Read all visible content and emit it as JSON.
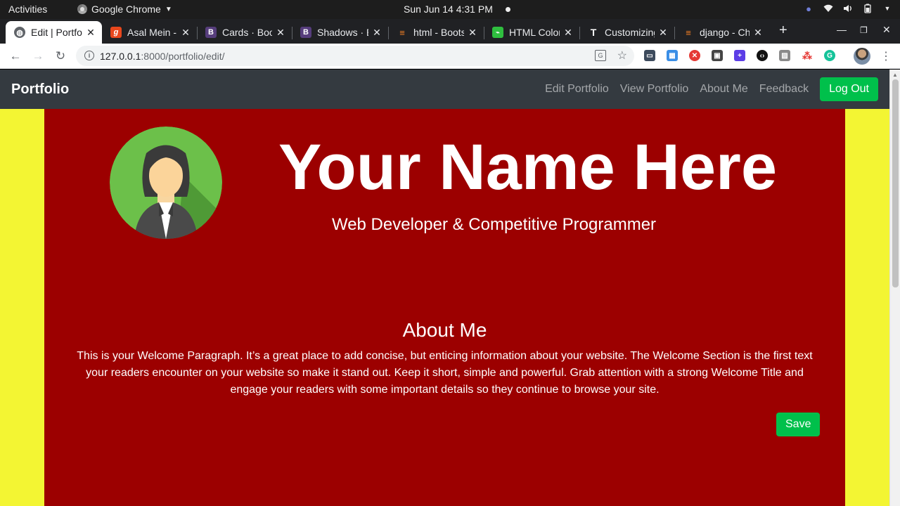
{
  "system_bar": {
    "activities": "Activities",
    "app_name": "Google Chrome",
    "clock": "Sun Jun 14   4:31 PM"
  },
  "tabs": [
    {
      "title": "Edit | Portfolio",
      "favicon": "globe-icon",
      "color": "#5f6368",
      "active": true
    },
    {
      "title": "Asal Mein - ",
      "favicon": "g",
      "color": "#e8471c",
      "active": false
    },
    {
      "title": "Cards · Bootstrap",
      "favicon": "B",
      "color": "#563d7c",
      "active": false
    },
    {
      "title": "Shadows · Bootstrap",
      "favicon": "B",
      "color": "#563d7c",
      "active": false
    },
    {
      "title": "html - Bootstrap",
      "favicon": "stackoverflow-icon",
      "color": "#f48024",
      "active": false
    },
    {
      "title": "HTML Color Codes",
      "favicon": "chart-icon",
      "color": "#2fbf3f",
      "active": false
    },
    {
      "title": "Customizing",
      "favicon": "T",
      "color": "#222222",
      "active": false
    },
    {
      "title": "django - Change",
      "favicon": "stackoverflow-icon",
      "color": "#f48024",
      "active": false
    }
  ],
  "address_bar": {
    "host": "127.0.0.1",
    "path": ":8000/portfolio/edit/"
  },
  "site": {
    "brand": "Portfolio",
    "nav": [
      "Edit Portfolio",
      "View Portfolio",
      "About Me",
      "Feedback"
    ],
    "logout_label": "Log Out",
    "name": "Your Name Here",
    "subtitle": "Web Developer & Competitive Programmer",
    "about_title": "About Me",
    "about_text": "This is your Welcome Paragraph. It’s a great place to add concise, but enticing information about your website. The Welcome Section is the first text your readers encounter on your website so make it stand out. Keep it short, simple and powerful. Grab attention with a strong Welcome Title and engage your readers with some important details so they continue to browse your site.",
    "save_label": "Save"
  },
  "colors": {
    "page_background": "#f3f533",
    "content_background": "#9c0000",
    "navbar": "#343a40",
    "accent_button": "#00c04b"
  }
}
